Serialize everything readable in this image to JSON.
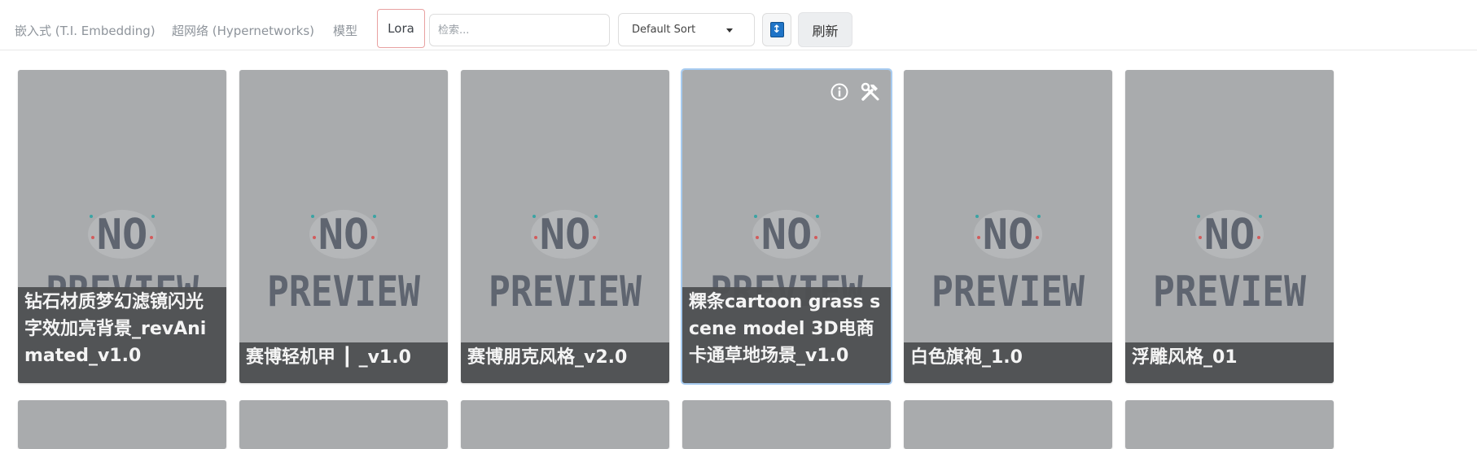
{
  "tabs": [
    {
      "label": "嵌入式 (T.I. Embedding)"
    },
    {
      "label": "超网络 (Hypernetworks)"
    },
    {
      "label": "模型"
    },
    {
      "label": "Lora"
    }
  ],
  "search": {
    "placeholder": "检索...",
    "value": ""
  },
  "sort": {
    "selected": "Default Sort"
  },
  "refresh_label": "刷新",
  "preview_text": {
    "line1": "NO",
    "line2": "PREVIEW"
  },
  "cards": [
    {
      "name": "钻石材质梦幻滤镜闪光字效加亮背景_revAnimated_v1.0"
    },
    {
      "name": "赛博轻机甲 ┃ _v1.0"
    },
    {
      "name": "赛博朋克风格_v2.0"
    },
    {
      "name": "粿条cartoon grass scene model 3D电商卡通草地场景_v1.0"
    },
    {
      "name": "白色旗袍_1.0"
    },
    {
      "name": "浮雕风格_01"
    }
  ],
  "colors": {
    "card_bg": "#a9abad",
    "caption_bg": "#4e5052",
    "highlight_border": "#a7cbf0",
    "lora_tab_border": "#e8a1a1"
  }
}
